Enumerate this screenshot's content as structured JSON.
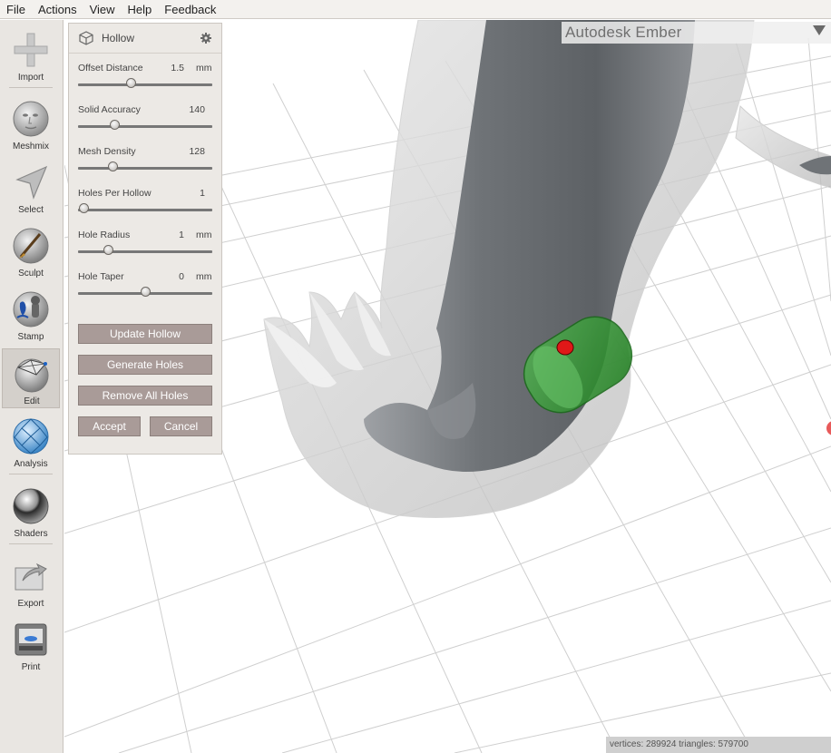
{
  "menu": [
    "File",
    "Actions",
    "View",
    "Help",
    "Feedback"
  ],
  "toolbar": {
    "items": [
      {
        "label": "Import",
        "icon": "plus-icon"
      },
      {
        "label": "Meshmix",
        "icon": "face-icon"
      },
      {
        "label": "Select",
        "icon": "arrow-cursor-icon"
      },
      {
        "label": "Sculpt",
        "icon": "brush-icon"
      },
      {
        "label": "Stamp",
        "icon": "stamp-icon"
      },
      {
        "label": "Edit",
        "icon": "edit-mesh-icon",
        "active": true
      },
      {
        "label": "Analysis",
        "icon": "geodesic-sphere-icon"
      },
      {
        "label": "Shaders",
        "icon": "chrome-sphere-icon"
      },
      {
        "label": "Export",
        "icon": "export-icon"
      },
      {
        "label": "Print",
        "icon": "printer-icon"
      }
    ]
  },
  "panel": {
    "title": "Hollow",
    "params": [
      {
        "label": "Offset Distance",
        "value": "1.5",
        "unit": "mm",
        "fraction": 0.39
      },
      {
        "label": "Solid Accuracy",
        "value": "140",
        "unit": "",
        "fraction": 0.27
      },
      {
        "label": "Mesh Density",
        "value": "128",
        "unit": "",
        "fraction": 0.26
      },
      {
        "label": "Holes Per Hollow",
        "value": "1",
        "unit": "",
        "fraction": 0.04
      },
      {
        "label": "Hole Radius",
        "value": "1",
        "unit": "mm",
        "fraction": 0.22
      },
      {
        "label": "Hole Taper",
        "value": "0",
        "unit": "mm",
        "fraction": 0.5
      }
    ],
    "buttons": {
      "update_hollow": "Update Hollow",
      "generate_holes": "Generate Holes",
      "remove_all_holes": "Remove All Holes",
      "accept": "Accept",
      "cancel": "Cancel"
    }
  },
  "viewport": {
    "brand": "Autodesk Ember",
    "stats": "vertices: 289924 triangles: 579700"
  },
  "colors": {
    "hole_green": "#2e9a2e",
    "hole_marker": "#e01818",
    "button_bg": "#a99b98",
    "panel_bg": "#ece9e5"
  }
}
